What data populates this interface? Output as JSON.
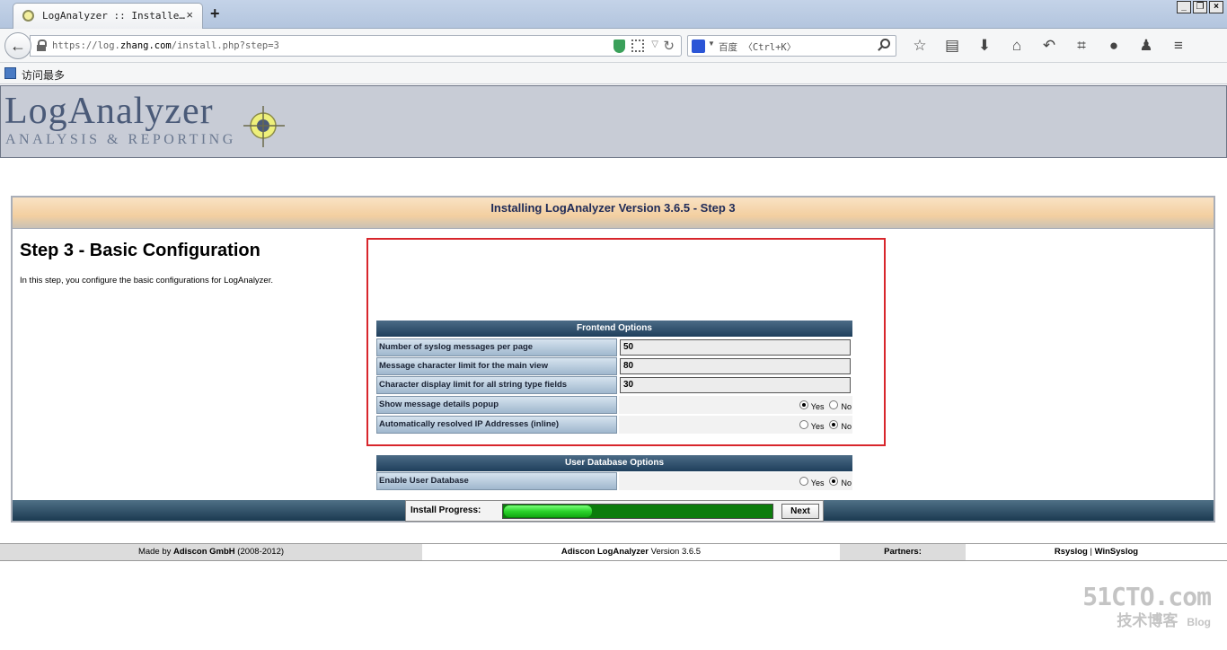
{
  "browser": {
    "tab_title": "LogAnalyzer :: Installe…",
    "tab_close": "×",
    "new_tab": "+",
    "url_prefix": "https://log.",
    "url_host": "zhang.com",
    "url_path": "/install.php?step=3",
    "search_placeholder": "百度 〈Ctrl+K〉",
    "bookmark_label": "访问最多",
    "window_buttons": [
      "_",
      "❐",
      "×"
    ],
    "toolbar_icons": [
      "star-icon",
      "reading-list-icon",
      "download-icon",
      "home-icon",
      "undo-icon",
      "crop-icon",
      "chat-icon",
      "user-icon",
      "menu-icon"
    ],
    "toolbar_glyphs": [
      "☆",
      "▤",
      "⬇",
      "⌂",
      "↶",
      "⌗",
      "●",
      "♟",
      "≡"
    ]
  },
  "logo": {
    "title": "LogAnalyzer",
    "subtitle": "ANALYSIS & REPORTING"
  },
  "install": {
    "header": "Installing LogAnalyzer Version 3.6.5 - Step 3",
    "step_title": "Step 3 - Basic Configuration",
    "step_desc": "In this step, you configure the basic configurations for LogAnalyzer.",
    "frontend_header": "Frontend Options",
    "fields": [
      {
        "label": "Number of syslog messages per page",
        "value": "50"
      },
      {
        "label": "Message character limit for the main view",
        "value": "80"
      },
      {
        "label": "Character display limit for all string type fields",
        "value": "30"
      }
    ],
    "radio_rows": [
      {
        "label": "Show message details popup",
        "selected": "Yes"
      },
      {
        "label": "Automatically resolved IP Addresses (inline)",
        "selected": "No"
      }
    ],
    "user_db_header": "User Database Options",
    "user_db_row": {
      "label": "Enable User Database",
      "selected": "No"
    },
    "yes_label": "Yes",
    "no_label": "No",
    "progress_label": "Install Progress:",
    "progress_fraction": 0.33,
    "next_label": "Next"
  },
  "footer": {
    "made_by_prefix": "Made by ",
    "made_by_company": "Adiscon GmbH",
    "made_by_years": " (2008-2012)",
    "product_name": "Adiscon LogAnalyzer",
    "product_version": " Version 3.6.5",
    "partners_label": "Partners:",
    "partner_1": "Rsyslog",
    "partner_sep": " | ",
    "partner_2": "WinSyslog"
  },
  "watermark": {
    "top": "51CTO.com",
    "bottom": "技术博客",
    "blog": "Blog"
  },
  "colors": {
    "highlight": "#d8262c",
    "progress": "#2bd32b",
    "section_header": "#1f3f5c"
  }
}
